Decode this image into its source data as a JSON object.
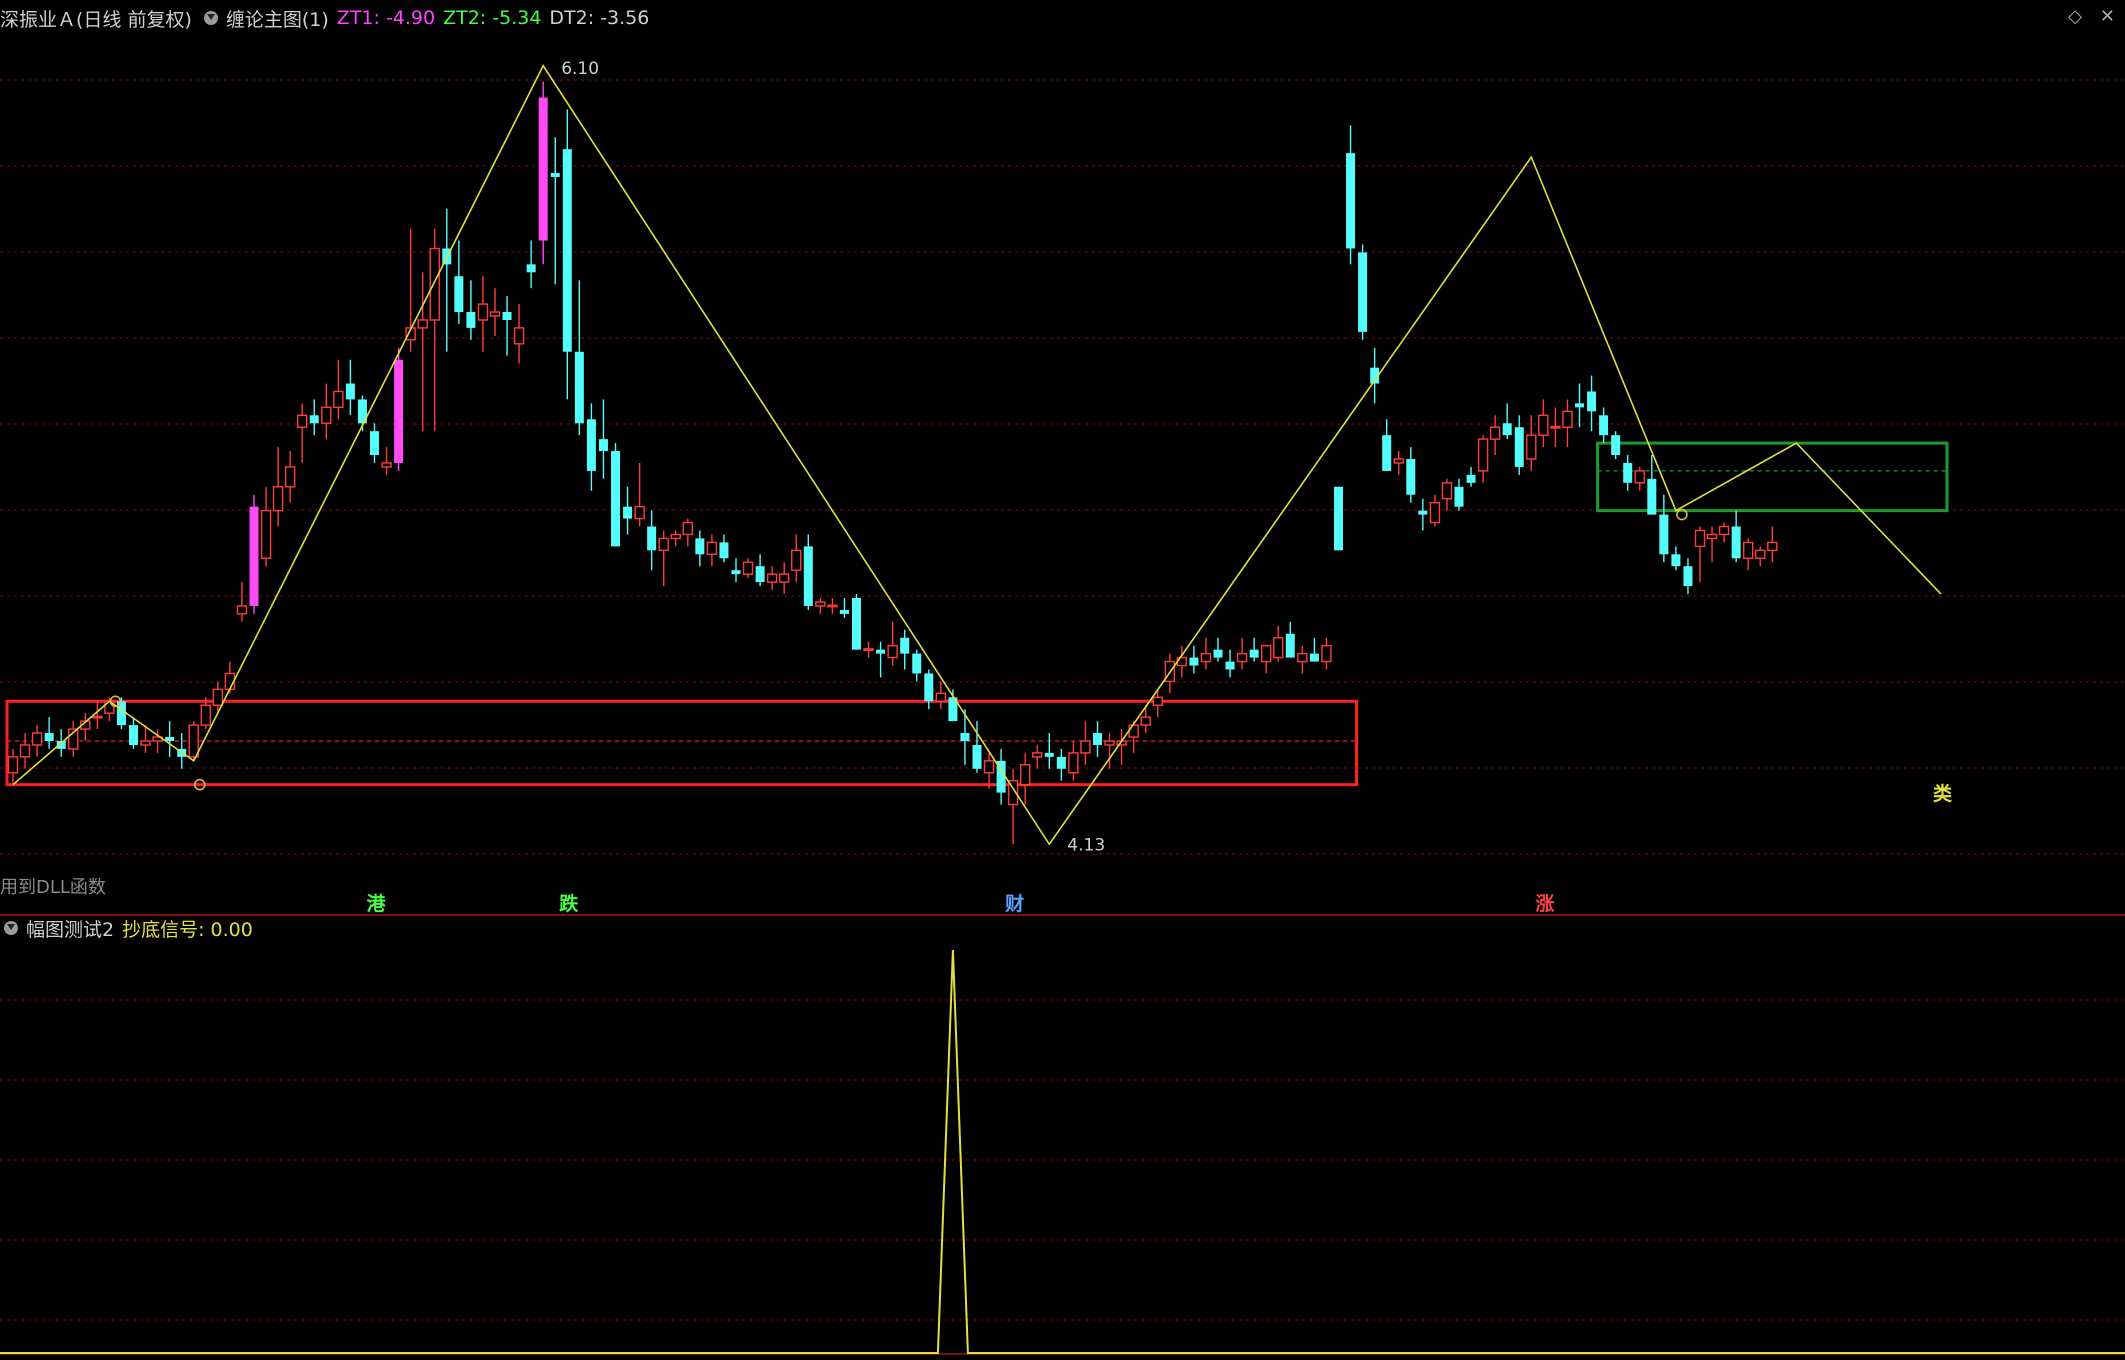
{
  "header": {
    "stock": "深振业Ａ(日线 前复权)",
    "indicator": "缠论主图(1)",
    "zt1_label": "ZT1: -4.90",
    "zt2_label": "ZT2: -5.34",
    "dt2_label": "DT2: -3.56"
  },
  "sub_header": {
    "indicator": "幅图测试2",
    "signal_label": "抄底信号: 0.00"
  },
  "main_note": "用到DLL函数",
  "corner_icons": [
    "diamond-icon",
    "close-icon"
  ],
  "colors": {
    "up": "#ff3c3c",
    "down": "#54fcfc",
    "limit_up": "#ff4cf5",
    "zigzag": "#e0e040",
    "grid": "#7a1010",
    "box_red": "#ff2020",
    "box_green": "#1f9a2a",
    "zt1": "#ff44ff",
    "zt2": "#44ff44",
    "signal_line": "#e0e040"
  },
  "chart_data": {
    "type": "candlestick",
    "price_axis_range": [
      4.05,
      6.18
    ],
    "candles": [
      [
        4.32,
        4.38,
        4.29,
        4.36
      ],
      [
        4.36,
        4.42,
        4.33,
        4.39
      ],
      [
        4.39,
        4.44,
        4.36,
        4.42
      ],
      [
        4.42,
        4.46,
        4.38,
        4.4
      ],
      [
        4.4,
        4.43,
        4.36,
        4.38
      ],
      [
        4.38,
        4.45,
        4.36,
        4.43
      ],
      [
        4.43,
        4.47,
        4.4,
        4.45
      ],
      [
        4.46,
        4.5,
        4.43,
        4.46
      ],
      [
        4.47,
        4.51,
        4.45,
        4.5
      ],
      [
        4.5,
        4.51,
        4.43,
        4.44
      ],
      [
        4.44,
        4.46,
        4.38,
        4.39
      ],
      [
        4.39,
        4.44,
        4.37,
        4.4
      ],
      [
        4.4,
        4.43,
        4.37,
        4.41
      ],
      [
        4.41,
        4.45,
        4.36,
        4.4
      ],
      [
        4.38,
        4.42,
        4.33,
        4.36
      ],
      [
        4.36,
        4.45,
        4.35,
        4.44
      ],
      [
        4.44,
        4.51,
        4.43,
        4.49
      ],
      [
        4.49,
        4.55,
        4.47,
        4.53
      ],
      [
        4.53,
        4.6,
        4.52,
        4.57
      ],
      [
        4.72,
        4.8,
        4.7,
        4.74
      ],
      [
        4.74,
        5.02,
        4.72,
        4.99
      ],
      [
        4.86,
        5.04,
        4.84,
        4.98
      ],
      [
        4.98,
        5.14,
        4.94,
        5.04
      ],
      [
        5.04,
        5.13,
        5.0,
        5.09
      ],
      [
        5.19,
        5.25,
        5.1,
        5.22
      ],
      [
        5.22,
        5.26,
        5.17,
        5.2
      ],
      [
        5.2,
        5.3,
        5.16,
        5.24
      ],
      [
        5.24,
        5.36,
        5.21,
        5.28
      ],
      [
        5.3,
        5.36,
        5.22,
        5.26
      ],
      [
        5.26,
        5.27,
        5.18,
        5.2
      ],
      [
        5.18,
        5.2,
        5.1,
        5.12
      ],
      [
        5.09,
        5.14,
        5.07,
        5.1
      ],
      [
        5.1,
        5.39,
        5.08,
        5.36
      ],
      [
        5.41,
        5.69,
        5.38,
        5.44
      ],
      [
        5.44,
        5.58,
        5.18,
        5.46
      ],
      [
        5.46,
        5.69,
        5.18,
        5.64
      ],
      [
        5.64,
        5.74,
        5.38,
        5.6
      ],
      [
        5.57,
        5.66,
        5.45,
        5.48
      ],
      [
        5.48,
        5.56,
        5.41,
        5.44
      ],
      [
        5.46,
        5.57,
        5.38,
        5.5
      ],
      [
        5.47,
        5.54,
        5.42,
        5.48
      ],
      [
        5.48,
        5.52,
        5.37,
        5.46
      ],
      [
        5.4,
        5.5,
        5.35,
        5.44
      ],
      [
        5.6,
        5.66,
        5.54,
        5.58
      ],
      [
        5.66,
        6.06,
        5.6,
        6.02
      ],
      [
        5.83,
        5.92,
        5.55,
        5.82
      ],
      [
        5.89,
        5.99,
        5.26,
        5.38
      ],
      [
        5.38,
        5.56,
        5.17,
        5.2
      ],
      [
        5.21,
        5.25,
        5.03,
        5.08
      ],
      [
        5.16,
        5.26,
        5.06,
        5.13
      ],
      [
        5.13,
        5.15,
        4.89,
        4.89
      ],
      [
        4.99,
        5.04,
        4.92,
        4.96
      ],
      [
        4.96,
        5.1,
        4.94,
        4.99
      ],
      [
        4.94,
        4.98,
        4.83,
        4.88
      ],
      [
        4.88,
        4.93,
        4.79,
        4.91
      ],
      [
        4.91,
        4.93,
        4.89,
        4.92
      ],
      [
        4.92,
        4.96,
        4.89,
        4.95
      ],
      [
        4.91,
        4.93,
        4.84,
        4.87
      ],
      [
        4.87,
        4.92,
        4.84,
        4.9
      ],
      [
        4.9,
        4.92,
        4.85,
        4.86
      ],
      [
        4.83,
        4.86,
        4.8,
        4.82
      ],
      [
        4.82,
        4.86,
        4.81,
        4.85
      ],
      [
        4.84,
        4.87,
        4.79,
        4.8
      ],
      [
        4.8,
        4.84,
        4.78,
        4.82
      ],
      [
        4.8,
        4.85,
        4.77,
        4.82
      ],
      [
        4.83,
        4.92,
        4.8,
        4.88
      ],
      [
        4.89,
        4.92,
        4.73,
        4.74
      ],
      [
        4.74,
        4.76,
        4.72,
        4.75
      ],
      [
        4.74,
        4.76,
        4.72,
        4.74
      ],
      [
        4.73,
        4.76,
        4.71,
        4.72
      ],
      [
        4.76,
        4.77,
        4.63,
        4.63
      ],
      [
        4.63,
        4.65,
        4.61,
        4.63
      ],
      [
        4.63,
        4.65,
        4.56,
        4.62
      ],
      [
        4.61,
        4.7,
        4.59,
        4.64
      ],
      [
        4.66,
        4.68,
        4.58,
        4.62
      ],
      [
        4.62,
        4.63,
        4.55,
        4.57
      ],
      [
        4.57,
        4.58,
        4.48,
        4.5
      ],
      [
        4.5,
        4.55,
        4.48,
        4.52
      ],
      [
        4.51,
        4.53,
        4.45,
        4.45
      ],
      [
        4.42,
        4.48,
        4.34,
        4.4
      ],
      [
        4.39,
        4.45,
        4.32,
        4.33
      ],
      [
        4.32,
        4.37,
        4.28,
        4.35
      ],
      [
        4.35,
        4.38,
        4.24,
        4.27
      ],
      [
        4.24,
        4.33,
        4.14,
        4.3
      ],
      [
        4.29,
        4.37,
        4.24,
        4.34
      ],
      [
        4.36,
        4.39,
        4.33,
        4.37
      ],
      [
        4.37,
        4.42,
        4.33,
        4.36
      ],
      [
        4.36,
        4.38,
        4.3,
        4.33
      ],
      [
        4.32,
        4.4,
        4.3,
        4.37
      ],
      [
        4.37,
        4.45,
        4.34,
        4.4
      ],
      [
        4.42,
        4.45,
        4.36,
        4.39
      ],
      [
        4.39,
        4.42,
        4.33,
        4.4
      ],
      [
        4.39,
        4.43,
        4.34,
        4.4
      ],
      [
        4.41,
        4.45,
        4.37,
        4.44
      ],
      [
        4.44,
        4.49,
        4.42,
        4.46
      ],
      [
        4.49,
        4.53,
        4.46,
        4.51
      ],
      [
        4.55,
        4.62,
        4.52,
        4.6
      ],
      [
        4.59,
        4.64,
        4.56,
        4.61
      ],
      [
        4.61,
        4.64,
        4.57,
        4.59
      ],
      [
        4.6,
        4.66,
        4.58,
        4.62
      ],
      [
        4.63,
        4.66,
        4.6,
        4.61
      ],
      [
        4.6,
        4.63,
        4.56,
        4.58
      ],
      [
        4.6,
        4.66,
        4.58,
        4.62
      ],
      [
        4.63,
        4.66,
        4.6,
        4.61
      ],
      [
        4.6,
        4.64,
        4.57,
        4.64
      ],
      [
        4.61,
        4.69,
        4.6,
        4.66
      ],
      [
        4.67,
        4.7,
        4.64,
        4.61
      ],
      [
        4.6,
        4.64,
        4.57,
        4.62
      ],
      [
        4.62,
        4.66,
        4.6,
        4.6
      ],
      [
        4.6,
        4.66,
        4.58,
        4.64
      ],
      [
        5.04,
        5.04,
        4.88,
        4.88
      ],
      [
        5.88,
        5.95,
        5.6,
        5.64
      ],
      [
        5.63,
        5.65,
        5.41,
        5.43
      ],
      [
        5.34,
        5.39,
        5.25,
        5.3
      ],
      [
        5.17,
        5.21,
        5.08,
        5.08
      ],
      [
        5.1,
        5.13,
        5.07,
        5.11
      ],
      [
        5.11,
        5.14,
        5.0,
        5.02
      ],
      [
        4.98,
        5.01,
        4.93,
        4.97
      ],
      [
        4.95,
        5.02,
        4.94,
        5.0
      ],
      [
        5.01,
        5.06,
        4.98,
        5.05
      ],
      [
        5.04,
        5.06,
        4.98,
        4.99
      ],
      [
        5.07,
        5.09,
        5.04,
        5.05
      ],
      [
        5.08,
        5.17,
        5.05,
        5.16
      ],
      [
        5.16,
        5.22,
        5.12,
        5.19
      ],
      [
        5.2,
        5.25,
        5.16,
        5.17
      ],
      [
        5.19,
        5.22,
        5.07,
        5.09
      ],
      [
        5.11,
        5.22,
        5.08,
        5.17
      ],
      [
        5.17,
        5.26,
        5.14,
        5.22
      ],
      [
        5.19,
        5.24,
        5.14,
        5.19
      ],
      [
        5.19,
        5.26,
        5.14,
        5.23
      ],
      [
        5.25,
        5.3,
        5.19,
        5.24
      ],
      [
        5.28,
        5.32,
        5.18,
        5.23
      ],
      [
        5.22,
        5.24,
        5.15,
        5.17
      ],
      [
        5.17,
        5.18,
        5.11,
        5.12
      ],
      [
        5.1,
        5.12,
        5.03,
        5.05
      ],
      [
        5.05,
        5.09,
        5.03,
        5.08
      ],
      [
        5.06,
        5.12,
        5.02,
        4.97
      ],
      [
        4.97,
        5.02,
        4.85,
        4.87
      ],
      [
        4.87,
        4.89,
        4.83,
        4.84
      ],
      [
        4.84,
        4.86,
        4.77,
        4.79
      ],
      [
        4.89,
        4.94,
        4.8,
        4.93
      ],
      [
        4.91,
        4.94,
        4.85,
        4.92
      ],
      [
        4.92,
        4.95,
        4.9,
        4.94
      ],
      [
        4.94,
        4.98,
        4.85,
        4.86
      ],
      [
        4.86,
        4.91,
        4.83,
        4.9
      ],
      [
        4.86,
        4.89,
        4.84,
        4.88
      ],
      [
        4.88,
        4.94,
        4.85,
        4.9
      ]
    ],
    "zigzag": [
      [
        0,
        4.29
      ],
      [
        8,
        4.5
      ],
      [
        15,
        4.35
      ],
      [
        44,
        6.1
      ],
      [
        86,
        4.14
      ],
      [
        126,
        5.87
      ],
      [
        138,
        4.98
      ],
      [
        148,
        5.15
      ],
      [
        160,
        4.77
      ]
    ],
    "pivot_labels": [
      {
        "bar": 44,
        "price": 6.1,
        "text": "6.10"
      },
      {
        "bar": 86,
        "price": 4.14,
        "text": "4.13"
      }
    ],
    "center_boxes": [
      {
        "color": "red",
        "from": 0,
        "to": 111,
        "top": 4.5,
        "bottom": 4.29,
        "mid": 4.4
      },
      {
        "color": "green",
        "from": 132,
        "to": 160,
        "top": 5.15,
        "bottom": 4.98,
        "mid": 5.08
      }
    ],
    "markers": [
      {
        "bar": 30,
        "text": "港",
        "color": "#44ff44"
      },
      {
        "bar": 46,
        "text": "跌",
        "color": "#44ff44"
      },
      {
        "bar": 83,
        "text": "财",
        "color": "#5aa0ff"
      },
      {
        "bar": 127,
        "text": "涨",
        "color": "#ff4040"
      },
      {
        "bar": 160,
        "text": "类",
        "color": "#e0e040"
      }
    ],
    "signal_series": {
      "name": "抄底信号",
      "spike_bar": 78,
      "spike_value": 1.0,
      "base": 0.0
    }
  }
}
